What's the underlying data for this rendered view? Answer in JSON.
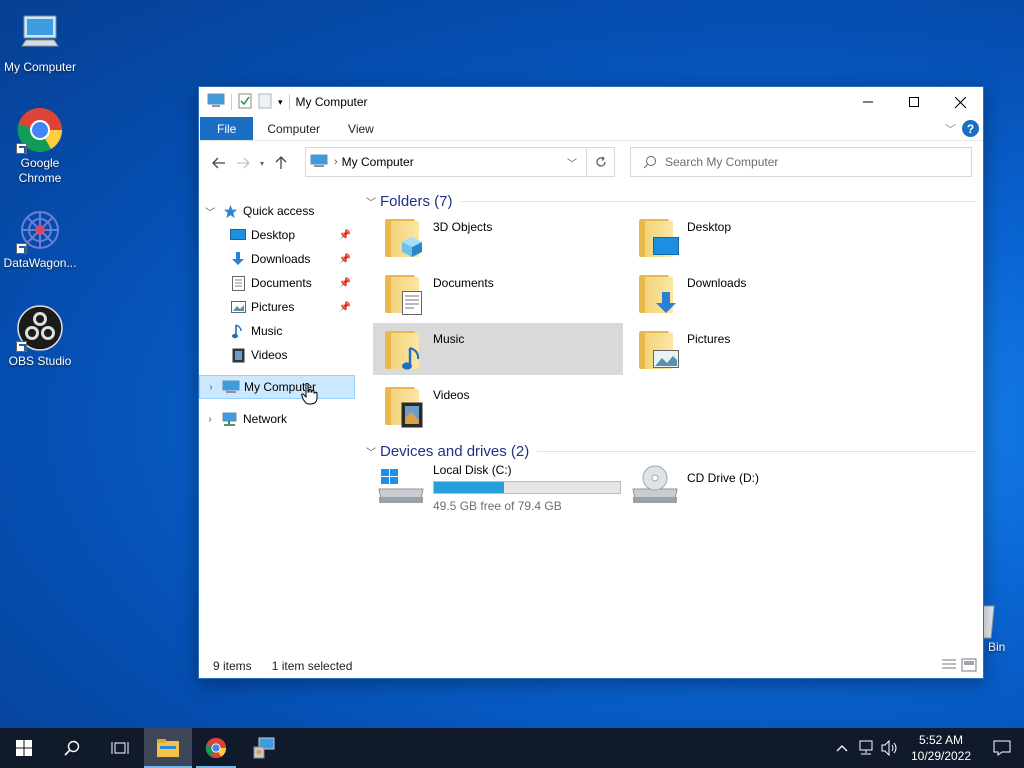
{
  "desktop": {
    "icons": [
      {
        "label": "My Computer",
        "icon": "computer-icon"
      },
      {
        "label": "Google Chrome",
        "icon": "chrome-icon"
      },
      {
        "label": "DataWagon...",
        "icon": "datawagon-icon"
      },
      {
        "label": "OBS Studio",
        "icon": "obs-icon"
      }
    ],
    "recycle_partial": "Bin"
  },
  "window": {
    "title": "My Computer",
    "ribbon_tabs": [
      "File",
      "Computer",
      "View"
    ],
    "address": "My Computer",
    "search_placeholder": "Search My Computer",
    "accent": "#1a6fc4"
  },
  "nav_pane": {
    "quick_access": "Quick access",
    "items": [
      {
        "label": "Desktop",
        "icon": "desktop-folder-icon",
        "pinned": true
      },
      {
        "label": "Downloads",
        "icon": "download-arrow-icon",
        "pinned": true
      },
      {
        "label": "Documents",
        "icon": "documents-icon",
        "pinned": true
      },
      {
        "label": "Pictures",
        "icon": "pictures-icon",
        "pinned": true
      },
      {
        "label": "Music",
        "icon": "music-note-icon",
        "pinned": false
      },
      {
        "label": "Videos",
        "icon": "film-icon",
        "pinned": false
      }
    ],
    "my_computer": "My Computer",
    "network": "Network"
  },
  "content": {
    "folders_header": "Folders (7)",
    "folders": [
      {
        "label": "3D Objects",
        "icon": "3d-objects-icon"
      },
      {
        "label": "Desktop",
        "icon": "desktop-folder-icon"
      },
      {
        "label": "Documents",
        "icon": "documents-icon"
      },
      {
        "label": "Downloads",
        "icon": "download-arrow-icon"
      },
      {
        "label": "Music",
        "icon": "music-note-icon",
        "selected": true
      },
      {
        "label": "Pictures",
        "icon": "pictures-icon"
      },
      {
        "label": "Videos",
        "icon": "film-icon"
      }
    ],
    "drives_header": "Devices and drives (2)",
    "drives": [
      {
        "label": "Local Disk (C:)",
        "free_text": "49.5 GB free of 79.4 GB",
        "used_fraction": 0.377
      },
      {
        "label": "CD Drive (D:)"
      }
    ]
  },
  "status": {
    "items": "9 items",
    "selected": "1 item selected"
  },
  "taskbar": {
    "time": "5:52 AM",
    "date": "10/29/2022"
  }
}
